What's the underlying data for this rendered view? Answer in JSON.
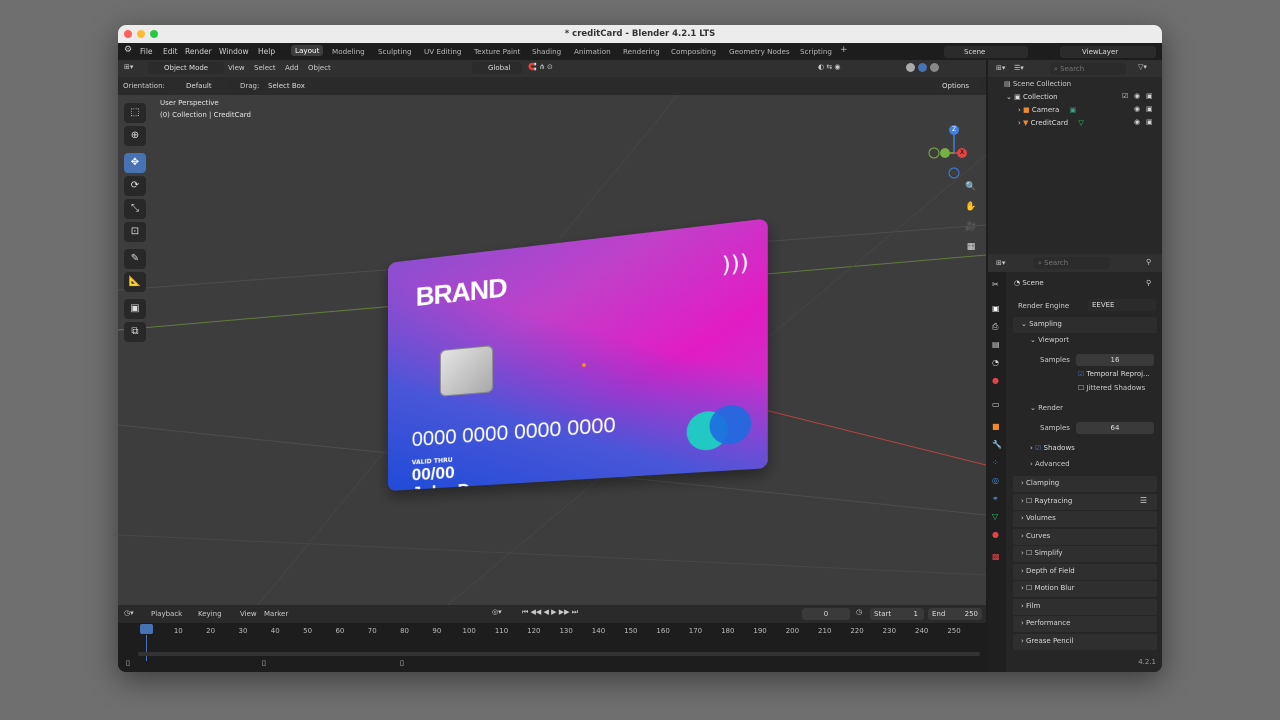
{
  "window": {
    "title": "* creditCard - Blender 4.2.1 LTS"
  },
  "menu": {
    "items": [
      "File",
      "Edit",
      "Render",
      "Window",
      "Help"
    ]
  },
  "workspaces": [
    "Layout",
    "Modeling",
    "Sculpting",
    "UV Editing",
    "Texture Paint",
    "Shading",
    "Animation",
    "Rendering",
    "Compositing",
    "Geometry Nodes",
    "Scripting"
  ],
  "topbar": {
    "scene": "Scene",
    "view_layer": "ViewLayer",
    "add_workspace": "+"
  },
  "viewport_header": {
    "mode": "Object Mode",
    "menus": [
      "View",
      "Select",
      "Add",
      "Object"
    ],
    "transform": "Global",
    "orientation_label": "Orientation:",
    "orientation_value": "Default",
    "drag_label": "Drag:",
    "drag_value": "Select Box",
    "options": "Options"
  },
  "viewport": {
    "view_name": "User Perspective",
    "collection_info": "(0) Collection | CreditCard",
    "gizmo": {
      "z": "Z",
      "x": "X"
    }
  },
  "card": {
    "brand": "BRAND",
    "number": "0000 0000 0000 0000",
    "valid_label": "VALID THRU",
    "valid_date": "00/00",
    "holder": "John Doe"
  },
  "outliner": {
    "search_placeholder": "Search",
    "scene_collection": "Scene Collection",
    "collection": "Collection",
    "items": [
      {
        "label": "Camera",
        "icon": "camera-icon"
      },
      {
        "label": "CreditCard",
        "icon": "mesh-icon"
      }
    ]
  },
  "properties": {
    "search_placeholder": "Search",
    "scene_label": "Scene",
    "render_engine_label": "Render Engine",
    "render_engine_value": "EEVEE",
    "sampling": "Sampling",
    "viewport": "Viewport",
    "samples_label": "Samples",
    "viewport_samples": "16",
    "temporal_reproj": "Temporal Reproj...",
    "jittered_shadows": "Jittered Shadows",
    "render": "Render",
    "render_samples": "64",
    "shadows": "Shadows",
    "advanced": "Advanced",
    "panels": [
      "Clamping",
      "Raytracing",
      "Volumes",
      "Curves",
      "Simplify",
      "Depth of Field",
      "Motion Blur",
      "Film",
      "Performance",
      "Grease Pencil"
    ]
  },
  "timeline": {
    "menus": [
      "Playback",
      "Keying",
      "View",
      "Marker"
    ],
    "current_frame": "0",
    "start_label": "Start",
    "start": "1",
    "end_label": "End",
    "end": "250",
    "ticks": [
      "0",
      "10",
      "20",
      "30",
      "40",
      "50",
      "60",
      "70",
      "80",
      "90",
      "100",
      "110",
      "120",
      "130",
      "140",
      "150",
      "160",
      "170",
      "180",
      "190",
      "200",
      "210",
      "220",
      "230",
      "240",
      "250"
    ]
  },
  "status": {
    "version": "4.2.1"
  },
  "colors": {
    "accent": "#4772b3",
    "card_pink": "#e21cc4",
    "card_blue": "#1f4bd8",
    "x_axis": "#e04444",
    "y_axis": "#76b043",
    "z_axis": "#3f7fdf"
  }
}
